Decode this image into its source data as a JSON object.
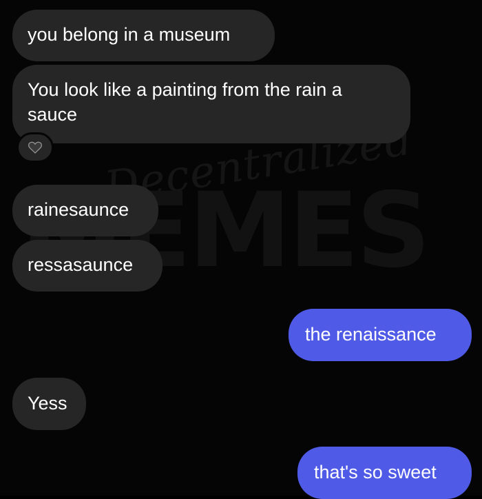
{
  "watermark": {
    "script_text": "Decentralized",
    "block_text": "MEMES"
  },
  "messages": [
    {
      "direction": "incoming",
      "text": "you belong in a museum"
    },
    {
      "direction": "incoming",
      "text": "You look like a painting from the rain a sauce"
    },
    {
      "direction": "incoming",
      "text": "rainesaunce"
    },
    {
      "direction": "incoming",
      "text": "ressasaunce"
    },
    {
      "direction": "outgoing",
      "text": "the renaissance"
    },
    {
      "direction": "incoming",
      "text": "Yess"
    },
    {
      "direction": "outgoing",
      "text": "that's so sweet"
    }
  ],
  "reaction": {
    "icon": "black-heart-icon",
    "on_message": 2
  },
  "colors": {
    "background": "#050505",
    "incoming_bubble": "#262626",
    "outgoing_bubble": "#4f5be6",
    "text": "#ffffff"
  }
}
